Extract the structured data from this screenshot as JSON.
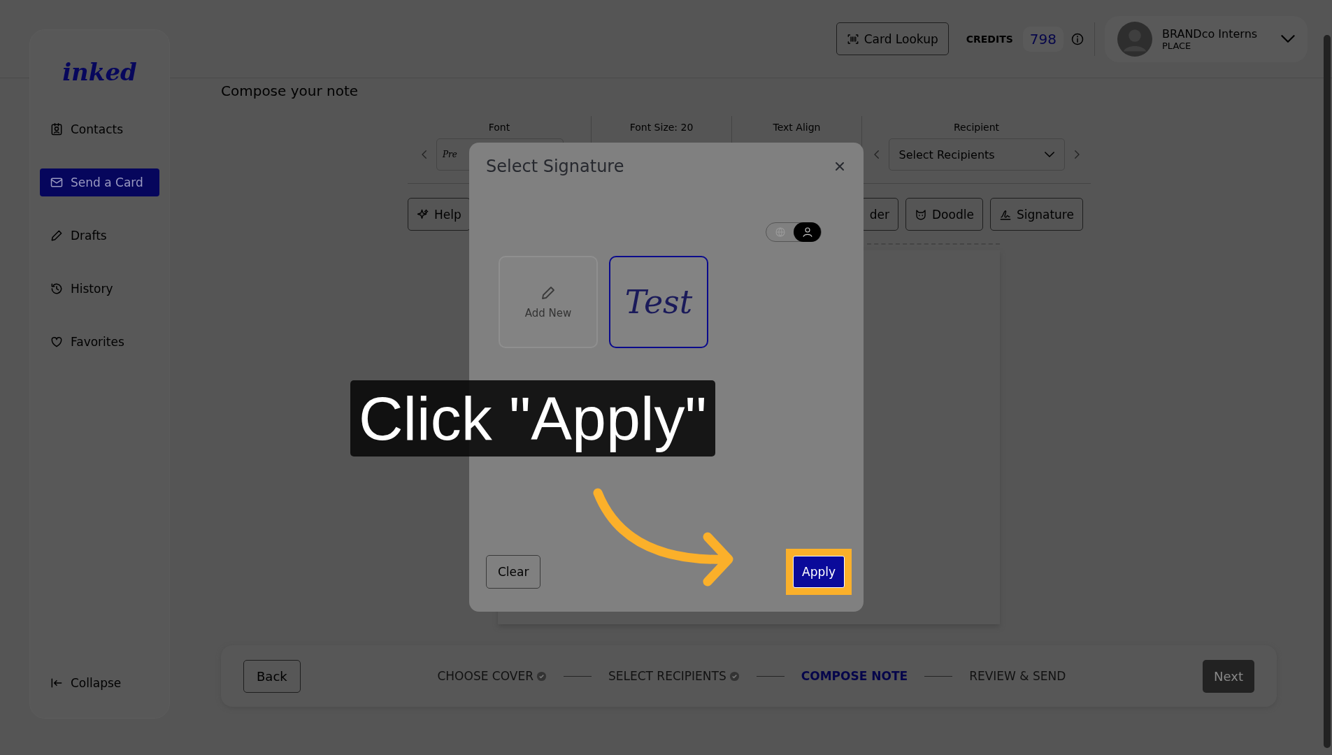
{
  "sidebar": {
    "logo": "inked",
    "items": [
      {
        "label": "Contacts",
        "kind": "contacts",
        "selected": false
      },
      {
        "label": "Send a Card",
        "kind": "send",
        "selected": true
      },
      {
        "label": "Drafts",
        "kind": "drafts",
        "selected": false
      },
      {
        "label": "History",
        "kind": "history",
        "selected": false
      },
      {
        "label": "Favorites",
        "kind": "favorites",
        "selected": false
      }
    ],
    "collapse": "Collapse"
  },
  "topbar": {
    "card_lookup": "Card Lookup",
    "credits_label": "CREDITS",
    "credits": "798",
    "user_name": "BRANDco Interns",
    "user_place": "PLACE"
  },
  "page_title": "Compose your note",
  "toolbar": {
    "font_label": "Font",
    "font_value": "Pre",
    "font_size_label": "Font Size: 20",
    "text_align_label": "Text Align",
    "recipient_label": "Recipient",
    "recipient_placeholder": "Select Recipients"
  },
  "tools": [
    {
      "label": "Help",
      "kind": "help"
    },
    {
      "label": "der",
      "kind": "plain"
    },
    {
      "label": "Doodle",
      "kind": "doodle"
    },
    {
      "label": "Signature",
      "kind": "signature"
    }
  ],
  "modal": {
    "title": "Select Signature",
    "toggle": [
      {
        "kind": "globe",
        "selected": false
      },
      {
        "kind": "person",
        "selected": true
      }
    ],
    "tiles": [
      {
        "kind": "add",
        "label": "Add New",
        "selected": false
      },
      {
        "kind": "signature",
        "label": "Test",
        "selected": true
      }
    ],
    "clear": "Clear",
    "apply": "Apply"
  },
  "callout": "Click \"Apply\"",
  "steps": [
    {
      "label": "CHOOSE COVER",
      "completed": true,
      "selected": false
    },
    {
      "label": "SELECT RECIPIENTS",
      "completed": true,
      "selected": false
    },
    {
      "label": "COMPOSE NOTE",
      "completed": false,
      "selected": true
    },
    {
      "label": "REVIEW & SEND",
      "completed": false,
      "selected": false
    }
  ],
  "back": "Back",
  "next": "Next"
}
